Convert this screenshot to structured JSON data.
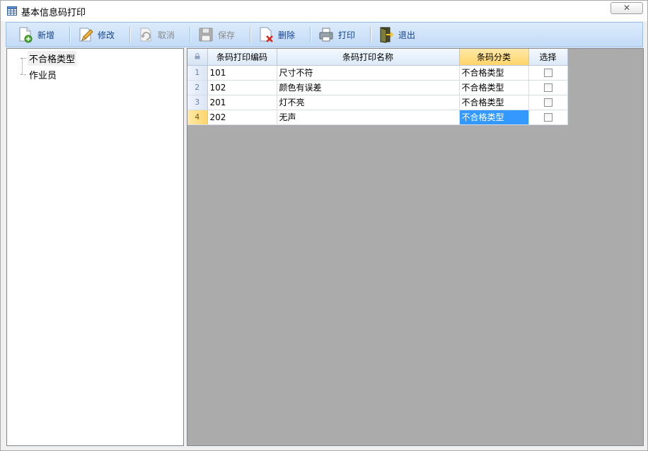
{
  "window": {
    "title": "基本信息码打印",
    "close_icon": "close-icon"
  },
  "toolbar": {
    "items": [
      {
        "key": "new",
        "label": "新增",
        "icon": "new-document-icon",
        "enabled": true
      },
      {
        "key": "edit",
        "label": "修改",
        "icon": "edit-pencil-icon",
        "enabled": true
      },
      {
        "key": "cancel",
        "label": "取消",
        "icon": "undo-icon",
        "enabled": false
      },
      {
        "key": "save",
        "label": "保存",
        "icon": "floppy-disk-icon",
        "enabled": false
      },
      {
        "key": "delete",
        "label": "删除",
        "icon": "delete-document-icon",
        "enabled": true
      },
      {
        "key": "print",
        "label": "打印",
        "icon": "printer-icon",
        "enabled": true
      },
      {
        "key": "exit",
        "label": "退出",
        "icon": "exit-door-icon",
        "enabled": true
      }
    ]
  },
  "tree": {
    "nodes": [
      {
        "label": "不合格类型",
        "selected": true
      },
      {
        "label": "作业员",
        "selected": false
      }
    ]
  },
  "grid": {
    "columns": [
      "条码打印编码",
      "条码打印名称",
      "条码分类",
      "选择"
    ],
    "active_column": 2,
    "rows": [
      {
        "num": "1",
        "code": "101",
        "name": "尺寸不符",
        "category": "不合格类型",
        "checked": false
      },
      {
        "num": "2",
        "code": "102",
        "name": "颜色有误差",
        "category": "不合格类型",
        "checked": false
      },
      {
        "num": "3",
        "code": "201",
        "name": "灯不亮",
        "category": "不合格类型",
        "checked": false
      },
      {
        "num": "4",
        "code": "202",
        "name": "无声",
        "category": "不合格类型",
        "checked": false
      }
    ],
    "current_row": 3
  },
  "colors": {
    "toolbar_bg": "#c3dbf7",
    "grid_bg": "#ababab",
    "selection": "#3399ff",
    "active_header": "#ffd56a"
  }
}
